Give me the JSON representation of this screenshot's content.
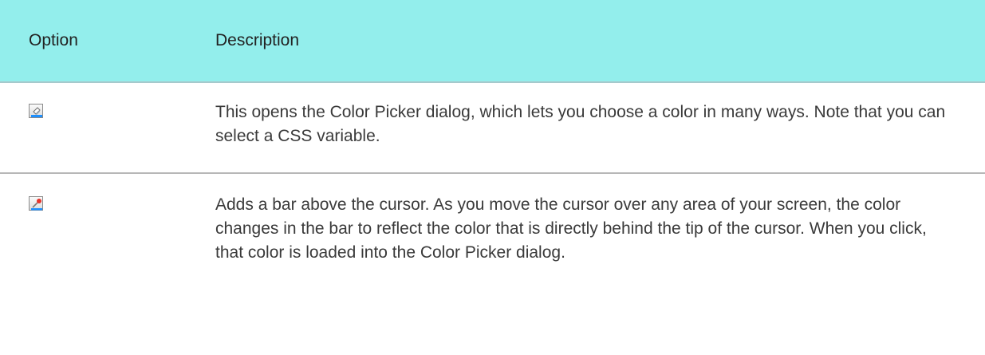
{
  "table": {
    "headers": {
      "option": "Option",
      "description": "Description"
    },
    "rows": [
      {
        "icon": "color-picker-icon",
        "description": "This opens the Color Picker dialog, which lets you choose a color in many ways. Note that you can select a CSS variable."
      },
      {
        "icon": "eyedropper-icon",
        "description": "Adds a bar above the cursor. As you move the cursor over any area of your screen, the color changes in the bar to reflect the color that is directly behind the tip of the cursor. When you click, that color is loaded into the Color Picker dialog."
      }
    ]
  },
  "colors": {
    "header_background": "#93eeec",
    "row_divider": "#b7b7b7",
    "icon_blue": "#1e90ff",
    "eyedropper_red": "#e8332a"
  }
}
